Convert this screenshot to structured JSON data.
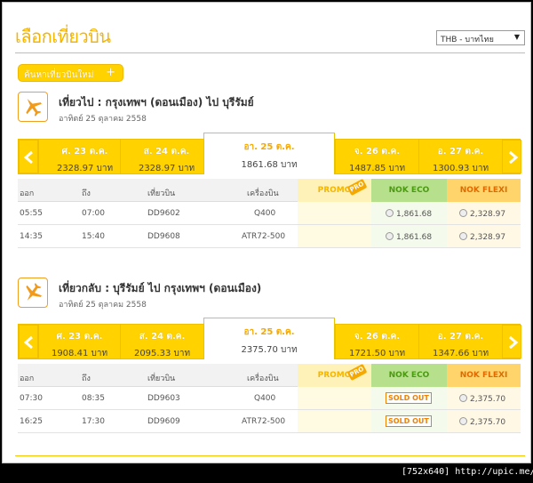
{
  "page_title": "เลือกเที่ยวบิน",
  "currency": {
    "selected": "THB - บาทไทย"
  },
  "new_search_label": "ค้นหาเที่ยวบินใหม่",
  "colors": {
    "accent": "#ffd200",
    "accent_text": "#f5b500",
    "eco": "#b7e08c",
    "flexi": "#ffd46a",
    "sold_out": "#f08000"
  },
  "table_headers": {
    "depart": "ออก",
    "arrive": "ถึง",
    "flight": "เที่ยวบิน",
    "aircraft": "เครื่องบิน",
    "promo": "PROMO",
    "promo_tag": "PRO",
    "eco": "NOK ECO",
    "flexi": "NOK FLEXI"
  },
  "outbound": {
    "title": "เที่ยวไป  :  กรุงเทพฯ (ดอนเมือง)  ไป  บุรีรัมย์",
    "date": "อาทิตย์ 25 ตุลาคม 2558",
    "icon": "departure-plane-icon",
    "dates": [
      {
        "day": "ศ. 23 ต.ค.",
        "price": "2328.97 บาท",
        "selected": false
      },
      {
        "day": "ส. 24 ต.ค.",
        "price": "2328.97 บาท",
        "selected": false
      },
      {
        "day": "อา. 25 ต.ค.",
        "price": "1861.68 บาท",
        "selected": true
      },
      {
        "day": "จ. 26 ต.ค.",
        "price": "1487.85 บาท",
        "selected": false
      },
      {
        "day": "อ. 27 ต.ค.",
        "price": "1300.93 บาท",
        "selected": false
      }
    ],
    "flights": [
      {
        "depart": "05:55",
        "arrive": "07:00",
        "flight": "DD9602",
        "aircraft": "Q400",
        "eco": "1,861.68",
        "eco_sold_out": false,
        "flexi": "2,328.97"
      },
      {
        "depart": "14:35",
        "arrive": "15:40",
        "flight": "DD9608",
        "aircraft": "ATR72-500",
        "eco": "1,861.68",
        "eco_sold_out": false,
        "flexi": "2,328.97"
      }
    ]
  },
  "return": {
    "title": "เที่ยวกลับ :  บุรีรัมย์  ไป  กรุงเทพฯ (ดอนเมือง)",
    "date": "อาทิตย์ 25 ตุลาคม 2558",
    "icon": "arrival-plane-icon",
    "dates": [
      {
        "day": "ศ. 23 ต.ค.",
        "price": "1908.41 บาท",
        "selected": false
      },
      {
        "day": "ส. 24 ต.ค.",
        "price": "2095.33 บาท",
        "selected": false
      },
      {
        "day": "อา. 25 ต.ค.",
        "price": "2375.70 บาท",
        "selected": true
      },
      {
        "day": "จ. 26 ต.ค.",
        "price": "1721.50 บาท",
        "selected": false
      },
      {
        "day": "อ. 27 ต.ค.",
        "price": "1347.66 บาท",
        "selected": false
      }
    ],
    "flights": [
      {
        "depart": "07:30",
        "arrive": "08:35",
        "flight": "DD9603",
        "aircraft": "Q400",
        "eco": "SOLD OUT",
        "eco_sold_out": true,
        "flexi": "2,375.70"
      },
      {
        "depart": "16:25",
        "arrive": "17:30",
        "flight": "DD9609",
        "aircraft": "ATR72-500",
        "eco": "SOLD OUT",
        "eco_sold_out": true,
        "flexi": "2,375.70"
      }
    ]
  },
  "watermark": "[752x640] http://upic.me/"
}
